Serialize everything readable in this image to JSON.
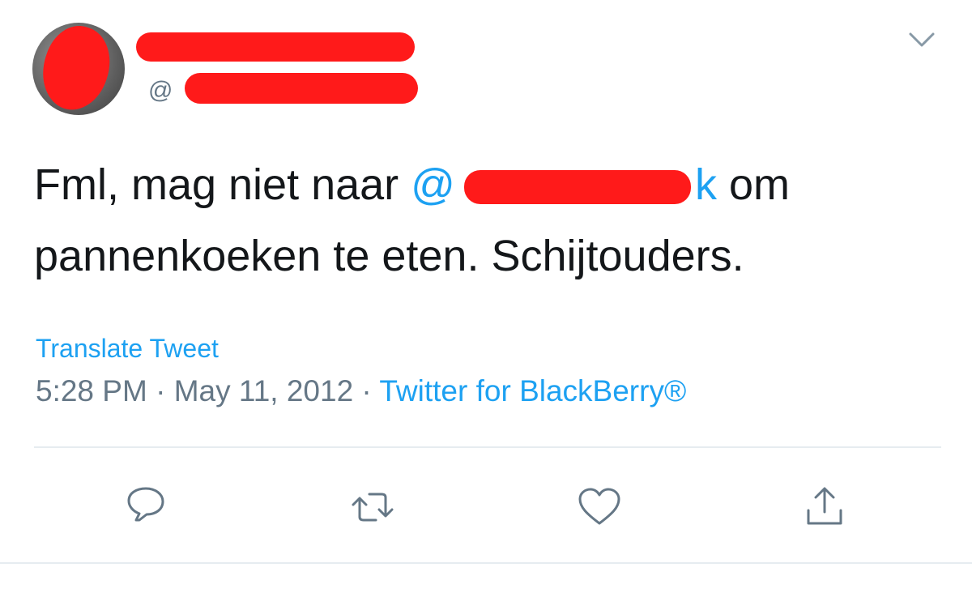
{
  "user": {
    "handle_prefix": "@"
  },
  "tweet": {
    "text_before_mention": "Fml, mag niet naar ",
    "mention_prefix": "@",
    "mention_suffix": "k",
    "text_after_mention": " om",
    "second_line": "pannenkoeken te eten. Schijtouders."
  },
  "translate_label": "Translate Tweet",
  "meta": {
    "time": "5:28 PM",
    "separator1": " · ",
    "date": "May 11, 2012",
    "separator2": " · ",
    "source": "Twitter for BlackBerry®"
  },
  "icons": {
    "caret": "chevron-down-icon",
    "reply": "reply-icon",
    "retweet": "retweet-icon",
    "like": "heart-icon",
    "share": "share-icon"
  },
  "colors": {
    "accent": "#1da1f2",
    "text": "#14171a",
    "secondary": "#657786",
    "redaction": "#ff1a1a"
  }
}
